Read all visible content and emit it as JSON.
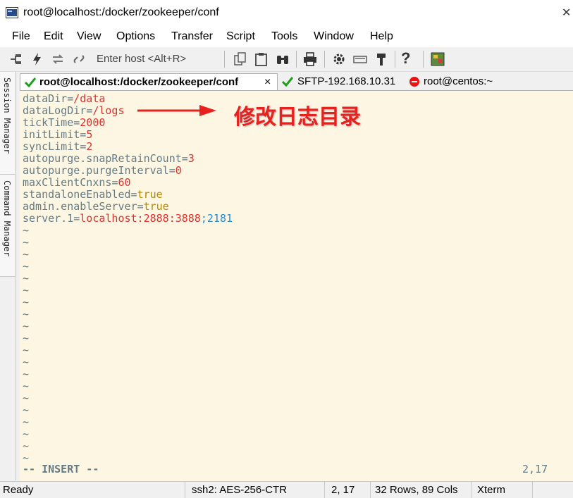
{
  "window": {
    "title": "root@localhost:/docker/zookeeper/conf",
    "close_glyph": "✕"
  },
  "menu": [
    "File",
    "Edit",
    "View",
    "Options",
    "Transfer",
    "Script",
    "Tools",
    "Window",
    "Help"
  ],
  "toolbar": {
    "host_placeholder": "Enter host <Alt+R>",
    "help_glyph": "?"
  },
  "side_panels": [
    "Session Manager",
    "Command Manager"
  ],
  "tabs": [
    {
      "label": "root@localhost:/docker/zookeeper/conf",
      "status": "connected",
      "active": true,
      "close": "×"
    },
    {
      "label": "SFTP-192.168.10.31",
      "status": "connected",
      "active": false
    },
    {
      "label": "root@centos:~",
      "status": "disconnected",
      "active": false
    }
  ],
  "editor": {
    "lines": [
      {
        "key": "dataDir",
        "eq": "=",
        "value": "/data"
      },
      {
        "key": "dataLogDir",
        "eq": "=",
        "value": "/logs"
      },
      {
        "key": "tickTime",
        "eq": "=",
        "value": "2000"
      },
      {
        "key": "initLimit",
        "eq": "=",
        "value": "5"
      },
      {
        "key": "syncLimit",
        "eq": "=",
        "value": "2"
      },
      {
        "key": "autopurge.snapRetainCount",
        "eq": "=",
        "value": "3"
      },
      {
        "key": "autopurge.purgeInterval",
        "eq": "=",
        "value": "0"
      },
      {
        "key": "maxClientCnxns",
        "eq": "=",
        "value": "60"
      },
      {
        "key": "standaloneEnabled",
        "eq": "=",
        "value": "true"
      },
      {
        "key": "admin.enableServer",
        "eq": "=",
        "value": "true"
      },
      {
        "key": "server.1",
        "eq": "=",
        "value": "localhost:2888:3888",
        "sep": ";",
        "extra": "2181"
      }
    ],
    "empty_line_marker": "~",
    "empty_lines": 20,
    "mode": "-- INSERT --",
    "cursor": "2,17"
  },
  "annotation": "修改日志目录",
  "colors": {
    "annotation": "#e6211e",
    "terminal_bg": "#fdf6e3",
    "value": "#dc322f",
    "keyword": "#b58900",
    "number": "#268bd2"
  },
  "statusbar": {
    "ready": "Ready",
    "cipher": "ssh2: AES-256-CTR",
    "position": "2,  17",
    "size": "32 Rows, 89 Cols",
    "term": "Xterm"
  }
}
